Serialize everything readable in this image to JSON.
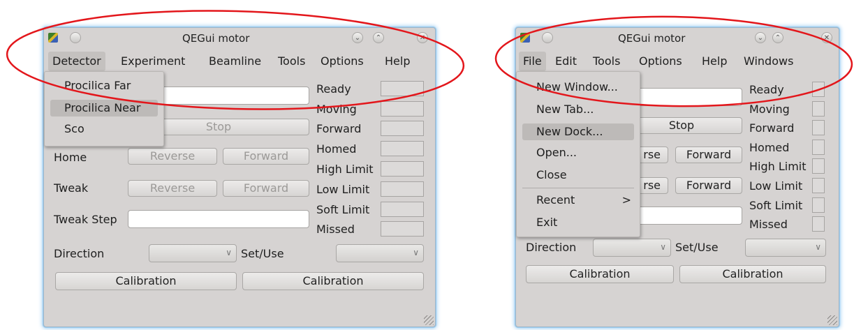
{
  "left": {
    "title": "QEGui motor",
    "menu": [
      "Detector",
      "Experiment",
      "Beamline",
      "Tools",
      "Options",
      "Help"
    ],
    "dropdown": [
      "Procilica Far",
      "Procilica Near",
      "Sco"
    ],
    "stop": "Stop",
    "home_label": "Home",
    "tweak_label": "Tweak",
    "reverse": "Reverse",
    "forward": "Forward",
    "tweak_step_label": "Tweak Step",
    "status": [
      "Ready",
      "Moving",
      "Forward",
      "Homed",
      "High Limit",
      "Low Limit",
      "Soft Limit",
      "Missed"
    ],
    "direction_label": "Direction",
    "setuse_label": "Set/Use",
    "calibration": "Calibration"
  },
  "right": {
    "title": "QEGui motor",
    "menu": [
      "File",
      "Edit",
      "Tools",
      "Options",
      "Help",
      "Windows"
    ],
    "dropdown": [
      "New Window...",
      "New Tab...",
      "New Dock...",
      "Open...",
      "Close",
      "Recent",
      "Exit"
    ],
    "recent_arrow": ">",
    "stop": "Stop",
    "reverse_partial": "rse",
    "forward": "Forward",
    "status": [
      "Ready",
      "Moving",
      "Forward",
      "Homed",
      "High Limit",
      "Low Limit",
      "Soft Limit",
      "Missed"
    ],
    "direction_label": "Direction",
    "setuse_label": "Set/Use",
    "calibration": "Calibration"
  },
  "icons": {
    "minimize": "⌄",
    "maximize": "⌃",
    "close": "✕",
    "combo_arrow": "∨"
  },
  "colors": {
    "annotation_ellipse": "#e3161b",
    "window_glow": "#a9d4f3"
  }
}
